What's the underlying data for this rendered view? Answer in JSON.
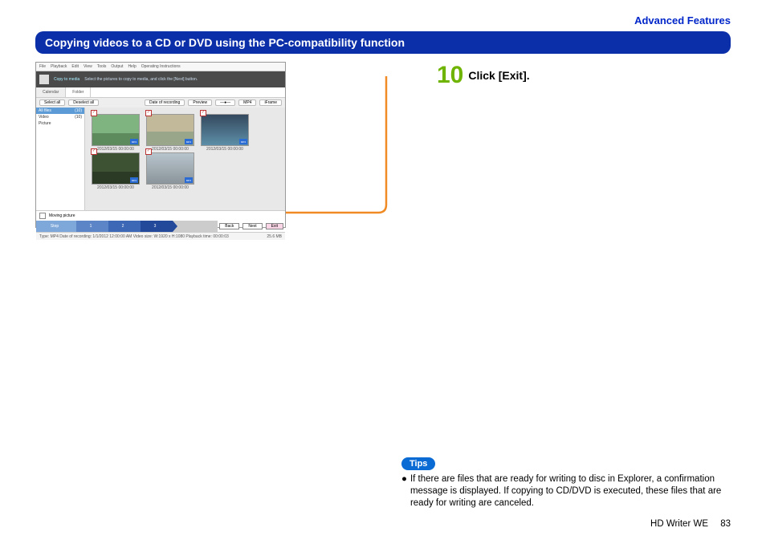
{
  "header": {
    "section": "Advanced Features",
    "title": "Copying videos to a CD or DVD using the PC-compatibility function"
  },
  "step": {
    "number": "10",
    "text": "Click [Exit]."
  },
  "screenshot": {
    "menu": [
      "File",
      "Playback",
      "Edit",
      "View",
      "Tools",
      "Output",
      "Help",
      "Operating Instructions"
    ],
    "banner_label": "Copy to media",
    "banner_hint": "Select the pictures to copy to media, and click the [Next] button.",
    "tabs": {
      "calendar": "Calendar",
      "folder": "Folder"
    },
    "toolbar": {
      "select_all": "Select all",
      "deselect_all": "Deselect all",
      "date_rec": "Date of recording",
      "preview": "Preview",
      "mp4": "MP4",
      "iframe": "iFrame"
    },
    "sidebar": {
      "all": "All files",
      "all_count": "(10)",
      "video": "Video",
      "video_count": "(10)",
      "picture": "Picture"
    },
    "thumbs": [
      {
        "cap": "2012/03/15 00:00:00"
      },
      {
        "cap": "2012/03/15 00:00:00"
      },
      {
        "cap": "2012/03/15 00:00:00"
      },
      {
        "cap": "2012/03/15 00:00:00"
      },
      {
        "cap": "2012/03/15 00:00:00"
      }
    ],
    "moving_picture": "Moving picture",
    "steps_label": "Step",
    "buttons": {
      "back": "Back",
      "next": "Next",
      "exit": "Exit"
    },
    "status_left": "Type: MP4  Date of recording: 1/1/2012 12:00:00 AM  Video size: W:1920 x H:1080 Playback time: 00:00:03",
    "status_right": "25.6 MB"
  },
  "tips": {
    "label": "Tips",
    "items": [
      "If there are files that are ready for writing to disc in Explorer, a confirmation message is displayed. If copying to CD/DVD is executed, these files that are ready for writing are canceled."
    ]
  },
  "footer": {
    "product": "HD Writer WE",
    "page": "83"
  }
}
